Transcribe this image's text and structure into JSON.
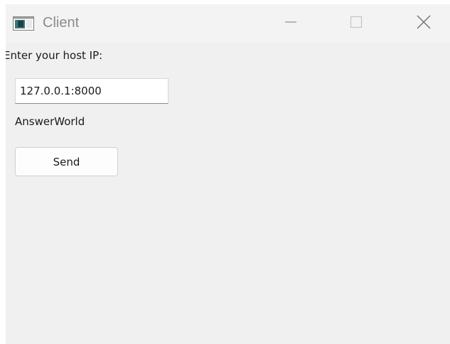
{
  "window": {
    "title": "Client",
    "app_icon": "app-window-icon",
    "controls": {
      "minimize_icon": "minimize-icon",
      "maximize_icon": "maximize-icon",
      "close_icon": "close-icon"
    }
  },
  "form": {
    "host_label": "Enter your host IP:",
    "host_value": "127.0.0.1:8000",
    "answer_text": "AnswerWorld",
    "send_label": "Send"
  },
  "colors": {
    "titlebar_bg": "#f3f3f3",
    "client_bg": "#f0f0f0",
    "title_text": "#8b8b8b"
  }
}
